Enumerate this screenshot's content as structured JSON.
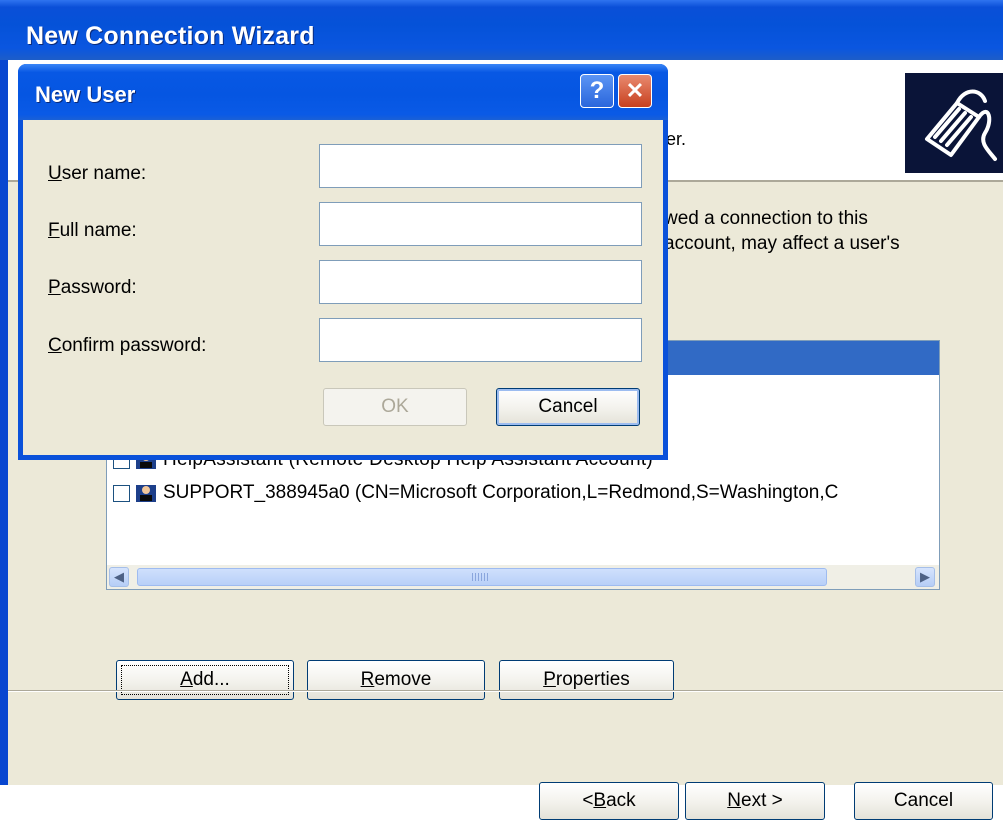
{
  "wizard": {
    "title": "New Connection Wizard",
    "header_subtext": "er.",
    "description_line1": "wed a connection to this",
    "description_line2": "account, may affect a user's",
    "list": {
      "rows": [
        {
          "text": "HelpAssistant (Remote Desktop Help Assistant Account)",
          "checked": false
        },
        {
          "text": "SUPPORT_388945a0 (CN=Microsoft Corporation,L=Redmond,S=Washington,C",
          "checked": false
        }
      ],
      "scroll_left": "◀",
      "scroll_right": "▶"
    },
    "buttons": {
      "add": "Add...",
      "remove": "Remove",
      "properties": "Properties",
      "back": "< Back",
      "next": "Next >",
      "cancel": "Cancel"
    }
  },
  "dialog": {
    "title": "New User",
    "help_glyph": "?",
    "close_glyph": "✕",
    "fields": {
      "user_name": {
        "label_u": "U",
        "label_rest": "ser name:",
        "value": ""
      },
      "full_name": {
        "label_u": "F",
        "label_rest": "ull name:",
        "value": ""
      },
      "password": {
        "label_u": "P",
        "label_rest": "assword:",
        "value": ""
      },
      "confirm_password": {
        "label_u": "C",
        "label_rest": "onfirm password:",
        "value": ""
      }
    },
    "ok": "OK",
    "cancel": "Cancel"
  },
  "icons": {
    "header": "network-cable-icon",
    "user": "user-account-icon"
  },
  "colors": {
    "titlebar": "#0552d8",
    "selection": "#316ac5",
    "face": "#ece9d8"
  }
}
